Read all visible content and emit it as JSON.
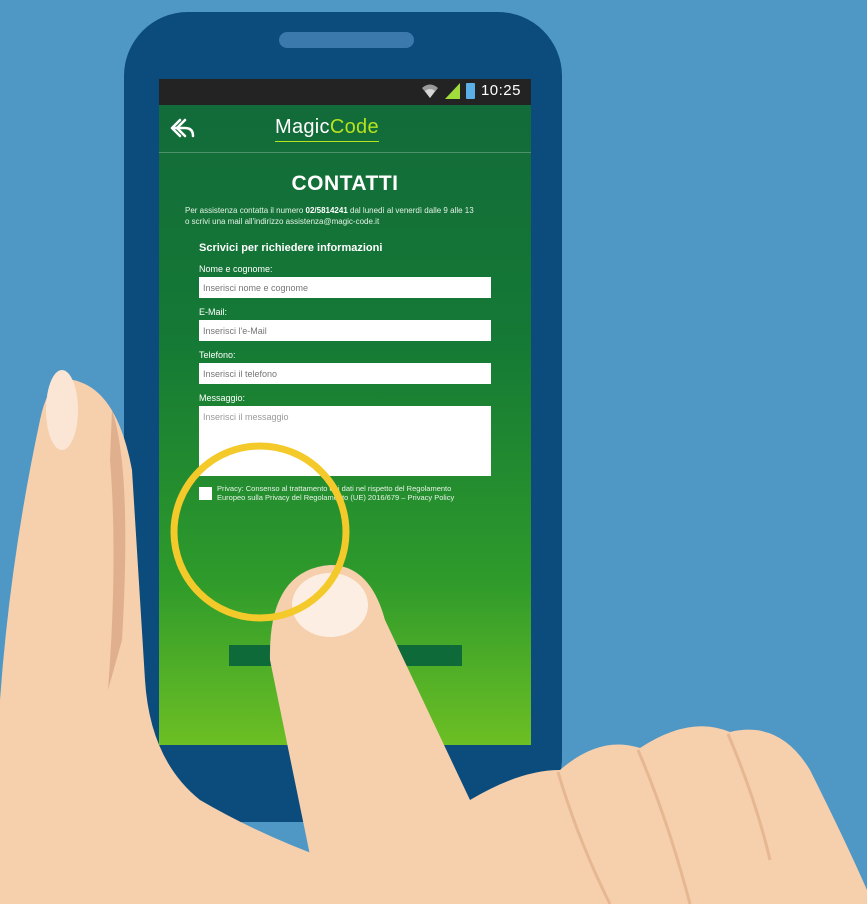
{
  "status_bar": {
    "time": "10:25"
  },
  "app_bar": {
    "logo_part1": "Magic",
    "logo_part2": "Code",
    "back_icon": "back-arrow-icon"
  },
  "page": {
    "title": "CONTATTI",
    "info_line1_a": "Per assistenza contatta il numero",
    "phone_number": "02/5814241",
    "info_line1_b": "dal lunedì al venerdì dalle 9 alle 13",
    "info_line2": "o scrivi una mail all'indirizzo assistenza@magic-code.it"
  },
  "form": {
    "heading": "Scrivici per richiedere informazioni",
    "name_label": "Nome e cognome:",
    "name_placeholder": "Inserisci nome e cognome",
    "email_label": "E-Mail:",
    "email_placeholder": "Inserisci l'e-Mail",
    "phone_label": "Telefono:",
    "phone_placeholder": "Inserisci il telefono",
    "message_label": "Messaggio:",
    "message_placeholder": "Inserisci il messaggio",
    "privacy_text": "Privacy: Consenso al trattamento dei dati nel rispetto del Regolamento Europeo sulla Privacy del Regolamento (UE) 2016/679 – Privacy Policy"
  },
  "colors": {
    "background": "#4f97c5",
    "phone_body": "#0b4c7c",
    "accent": "#b6e31f",
    "highlight_circle": "#f4c92a"
  }
}
